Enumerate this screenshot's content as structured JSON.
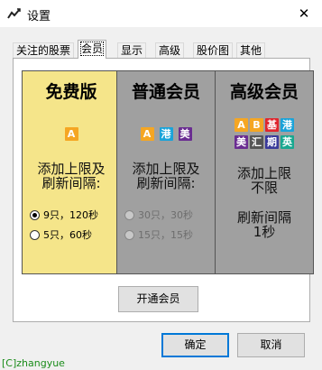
{
  "window": {
    "title": "设置",
    "close_glyph": "✕"
  },
  "tabs": [
    {
      "label": "关注的股票",
      "active": false
    },
    {
      "label": "会员",
      "active": true
    },
    {
      "label": "显示",
      "active": false
    },
    {
      "label": "高级",
      "active": false
    },
    {
      "label": "股价图",
      "active": false
    },
    {
      "label": "其他",
      "active": false
    }
  ],
  "cards": {
    "free": {
      "title": "免费版",
      "badges": [
        "A"
      ],
      "description": [
        "添加上限及",
        "刷新间隔:"
      ],
      "options": [
        {
          "label": "9只，120秒",
          "checked": true
        },
        {
          "label": "5只，60秒",
          "checked": false
        }
      ]
    },
    "normal": {
      "title": "普通会员",
      "badges": [
        "A",
        "港",
        "美"
      ],
      "description": [
        "添加上限及",
        "刷新间隔:"
      ],
      "options": [
        {
          "label": "30只，30秒",
          "checked": false
        },
        {
          "label": "15只，15秒",
          "checked": false
        }
      ]
    },
    "premium": {
      "title": "高级会员",
      "badges_row1": [
        "A",
        "B",
        "基",
        "港"
      ],
      "badges_row2": [
        "美",
        "汇",
        "期",
        "英"
      ],
      "limit_text": [
        "添加上限",
        "不限"
      ],
      "refresh_text": [
        "刷新间隔",
        "1秒"
      ]
    }
  },
  "buttons": {
    "open_membership": "开通会员",
    "ok": "确定",
    "cancel": "取消"
  },
  "footer": "[C]zhangyue",
  "colors": {
    "free_card": "#f5e58a",
    "member_card": "#a0a0a0",
    "accent": "#0078d7"
  }
}
